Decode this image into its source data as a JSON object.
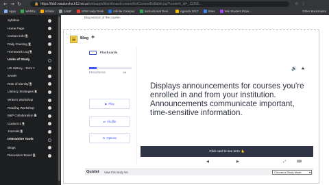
{
  "browser": {
    "nav_icons": [
      "←",
      "→",
      "↻"
    ],
    "lock_icon": "🔒",
    "url_main": "https://bb9.waukesha.k12.wi.us",
    "url_rest": "/webapps/blackboard/content/listContentEditable.jsp?content_id=_11358...",
    "right_icons": [
      "☆",
      "⋮"
    ]
  },
  "bookmarks": {
    "items": [
      {
        "label": "Apps",
        "color": "#8ab4f8"
      },
      {
        "label": "WebEx",
        "color": "#34a853"
      },
      {
        "label": "Infinite",
        "color": "#f9ab00"
      },
      {
        "label": "JAMF",
        "color": "#9aa0a6"
      },
      {
        "label": "SDW Help Desk",
        "color": "#ea4335"
      },
      {
        "label": "Infinite Campus",
        "color": "#1a73e8"
      },
      {
        "label": "Instructional Desi...",
        "color": "#34a853"
      },
      {
        "label": "Agenda 2017",
        "color": "#fbbc04"
      },
      {
        "label": "Sites",
        "color": "#4285f4"
      },
      {
        "label": "Wis Student Prive...",
        "color": "#a142f4"
      }
    ],
    "other": "Other Bookmarks"
  },
  "sidebar": {
    "items": [
      {
        "label": "Syllabus",
        "head": false,
        "dot": "solid"
      },
      {
        "label": "Home Page",
        "head": false,
        "dot": "solid"
      },
      {
        "label": "Contact Info 🖹",
        "head": false,
        "dot": "solid"
      },
      {
        "label": "Daily Greeting 🖹",
        "head": false,
        "dot": "solid"
      },
      {
        "label": "Homework Log 🖹",
        "head": false,
        "dot": "solid"
      },
      {
        "label": "Units of Study",
        "head": true,
        "dot": "hollow"
      },
      {
        "label": "US History - Term 1",
        "head": false,
        "dot": "solid"
      },
      {
        "label": "SAMR",
        "head": false,
        "dot": "solid"
      },
      {
        "label": "Role of Identity 🖹",
        "head": false,
        "dot": "solid"
      },
      {
        "label": "Literacy Strategies 🖹",
        "head": false,
        "dot": "solid"
      },
      {
        "label": "Writer's Workshop",
        "head": false,
        "dot": "solid"
      },
      {
        "label": "Reading Workshop",
        "head": false,
        "dot": "solid"
      },
      {
        "label": "B&P Collaboration 🖹",
        "head": false,
        "dot": "solid"
      },
      {
        "label": "Content 2 🖹",
        "head": false,
        "dot": "solid"
      },
      {
        "label": "Journals 🖹",
        "head": false,
        "dot": "solid"
      },
      {
        "label": "Interactive Tools",
        "head": true,
        "dot": "hollow"
      },
      {
        "label": "Blogs",
        "head": false,
        "dot": "solid"
      },
      {
        "label": "Discussion Board 🖹",
        "head": false,
        "dot": "solid"
      }
    ]
  },
  "main": {
    "top_fragment": "Blog section of the course.",
    "handle_icon": "⋮⋮",
    "blog_title": "Blog",
    "blog_plus": "✚"
  },
  "quizlet": {
    "flashcards_label": "Flashcards",
    "progress_label": "PROGRESS",
    "progress_count": "1/6",
    "progress_fraction": 0.17,
    "modes": [
      {
        "icon": "▶",
        "label": "Play"
      },
      {
        "icon": "⇄",
        "label": "Shuffle"
      },
      {
        "icon": "⚙",
        "label": "Options"
      }
    ],
    "card_icons": [
      "🔊",
      "★"
    ],
    "card_text": "Displays announcements for courses you're enrolled in and from your institution. Announcements communicate important, time-sensitive information.",
    "card_cta": "Click card to see term 👆",
    "controls": [
      "◀",
      "▶",
      "⤢",
      "⌨"
    ],
    "logo": "Quizlet",
    "view_link": "View this study set",
    "study_mode": "Choose a Study Mode",
    "study_mode_caret": "▾"
  }
}
